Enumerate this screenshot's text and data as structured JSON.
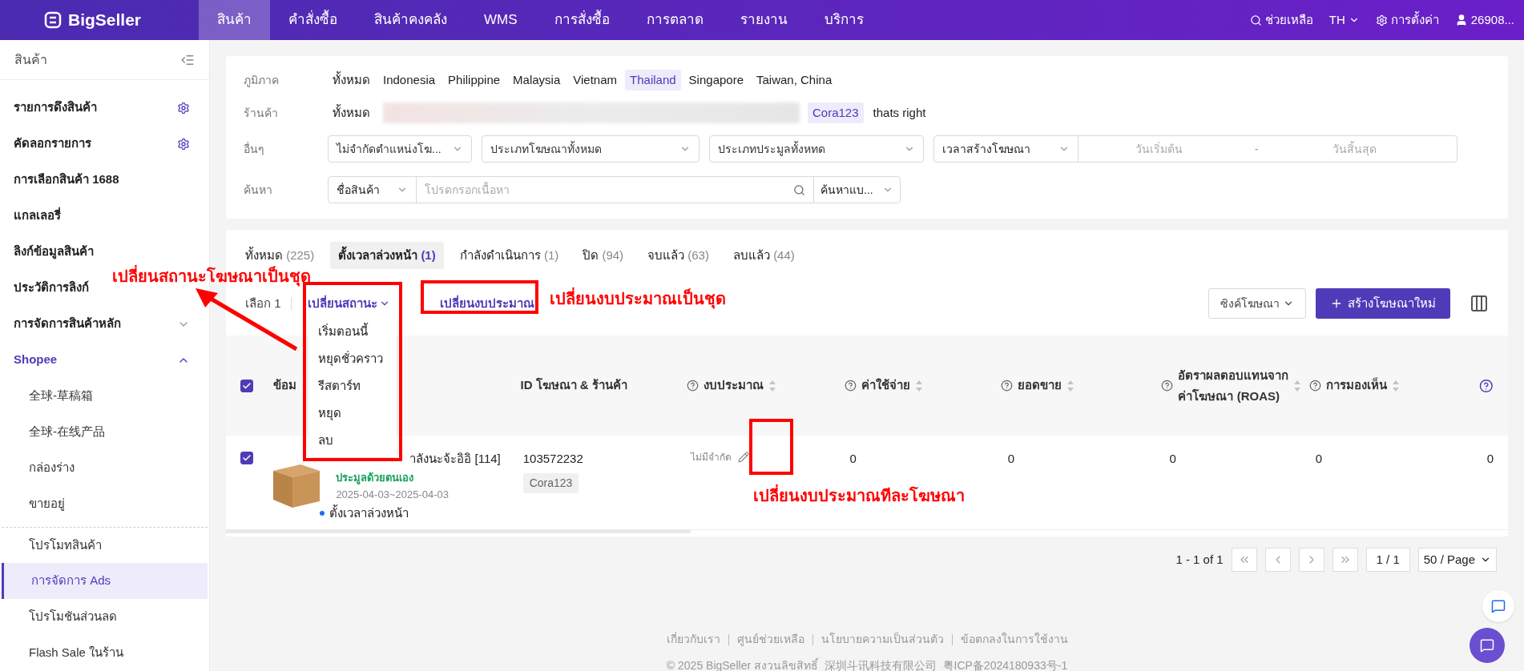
{
  "nav": {
    "logo": "BigSeller",
    "items": [
      {
        "label": "สินค้า",
        "selected": true
      },
      {
        "label": "คำสั่งซื้อ",
        "selected": false
      },
      {
        "label": "สินค้าคงคลัง",
        "selected": false
      },
      {
        "label": "WMS",
        "selected": false
      },
      {
        "label": "การสั่งซื้อ",
        "selected": false
      },
      {
        "label": "การตลาด",
        "selected": false
      },
      {
        "label": "รายงาน",
        "selected": false
      },
      {
        "label": "บริการ",
        "selected": false
      }
    ],
    "help": "ช่วยเหลือ",
    "lang": "TH",
    "settings": "การตั้งค่า",
    "user": "26908..."
  },
  "sidebar": {
    "title": "สินค้า",
    "items": [
      {
        "label": "รายการดึงสินค้า",
        "kind": "gear"
      },
      {
        "label": "คัดลอกรายการ",
        "kind": "gear"
      },
      {
        "label": "การเลือกสินค้า 1688",
        "kind": "plain"
      },
      {
        "label": "แกลเลอรี่",
        "kind": "plain"
      },
      {
        "label": "ลิงก์ข้อมูลสินค้า",
        "kind": "plain"
      },
      {
        "label": "ประวัติการลิงก์",
        "kind": "plain"
      },
      {
        "label": "การจัดการสินค้าหลัก",
        "kind": "group",
        "expanded": false
      },
      {
        "label": "Shopee",
        "kind": "group",
        "expanded": true,
        "children": [
          {
            "label": "全球-草稿箱",
            "selected": false,
            "divider_before": false
          },
          {
            "label": "全球-在线产品",
            "selected": false,
            "divider_before": false
          },
          {
            "label": "กล่องร่าง",
            "selected": false,
            "divider_before": false
          },
          {
            "label": "ขายอยู่",
            "selected": false,
            "divider_before": false
          },
          {
            "label": "โปรโมทสินค้า",
            "selected": false,
            "divider_before": true
          },
          {
            "label": "การจัดการ Ads",
            "selected": true,
            "divider_before": false
          },
          {
            "label": "โปรโมชันส่วนลด",
            "selected": false,
            "divider_before": false
          },
          {
            "label": "Flash Sale ในร้าน",
            "selected": false,
            "divider_before": false
          }
        ]
      }
    ]
  },
  "filters": {
    "region": {
      "label": "ภูมิภาค",
      "options": [
        {
          "label": "ทั้งหมด",
          "selected": false
        },
        {
          "label": "Indonesia",
          "selected": false
        },
        {
          "label": "Philippine",
          "selected": false
        },
        {
          "label": "Malaysia",
          "selected": false
        },
        {
          "label": "Vietnam",
          "selected": false
        },
        {
          "label": "Thailand",
          "selected": true
        },
        {
          "label": "Singapore",
          "selected": false
        },
        {
          "label": "Taiwan, China",
          "selected": false
        }
      ]
    },
    "store": {
      "label": "ร้านค้า",
      "all": "ทั้งหมด",
      "options": [
        {
          "label": "Cora123",
          "selected": true
        },
        {
          "label": "thats right",
          "selected": false
        }
      ]
    },
    "other": {
      "label": "อื่นๆ",
      "selects": [
        "ไม่จำกัดตำแหน่งโฆ...",
        "ประเภทโฆษณาทั้งหมด",
        "ประเภทประมูลทั้งหทด"
      ],
      "date_type": "เวลาสร้างโฆษณา",
      "start_placeholder": "วันเริ่มต้น",
      "separator": "-",
      "end_placeholder": "วันสิ้นสุด"
    },
    "search": {
      "label": "ค้นหา",
      "field": "ชื่อสินค้า",
      "placeholder": "โปรดกรอกเนื้อหา",
      "mode": "ค้นหาแบ..."
    }
  },
  "tabs": [
    {
      "label": "ทั้งหมด",
      "count": "(225)",
      "selected": false
    },
    {
      "label": "ตั้งเวลาล่วงหน้า",
      "count": "(1)",
      "selected": true
    },
    {
      "label": "กำลังดำเนินการ",
      "count": "(1)",
      "selected": false
    },
    {
      "label": "ปิด",
      "count": "(94)",
      "selected": false
    },
    {
      "label": "จบแล้ว",
      "count": "(63)",
      "selected": false
    },
    {
      "label": "ลบแล้ว",
      "count": "(44)",
      "selected": false
    }
  ],
  "toolbar": {
    "selected_count": "เลือก 1",
    "status_button": "เปลี่ยนสถานะ",
    "budget_button": "เปลี่ยนงบประมาณ",
    "sync_button": "ซิงค์โฆษณา",
    "create_button": "สร้างโฆษณาใหม่"
  },
  "status_menu": [
    "เริ่มตอนนี้",
    "หยุดชั่วคราว",
    "รีสตาร์ท",
    "หยุด",
    "ลบ"
  ],
  "table": {
    "all_checked": true,
    "columns": [
      {
        "label": "ข้อม",
        "help": false,
        "sortable": false
      },
      {
        "label": "ID โฆษณา & ร้านค้า",
        "help": false,
        "sortable": false
      },
      {
        "label": "งบประมาณ",
        "help": true,
        "sortable": true
      },
      {
        "label": "ค่าใช้จ่าย",
        "help": true,
        "sortable": true
      },
      {
        "label": "ยอดขาย",
        "help": true,
        "sortable": true
      },
      {
        "label": "อัตราผลตอบแทนจากค่าโฆษณา (ROAS)",
        "help": true,
        "sortable": true
      },
      {
        "label": "การมองเห็น",
        "help": true,
        "sortable": true
      }
    ],
    "rows": [
      {
        "checked": true,
        "name": "าลังนะจ้ะอิอิ [114]",
        "bidding": "ประมูลด้วยตนเอง",
        "dates": "2025-04-03~2025-04-03",
        "status": "ตั้งเวลาล่วงหน้า",
        "ad_id": "103572232",
        "store": "Cora123",
        "budget": "ไม่มีจำกัด",
        "spend": "0",
        "sales": "0",
        "roas": "0",
        "views": "0",
        "column_8": "0"
      }
    ]
  },
  "pagination": {
    "summary": "1 - 1 of 1",
    "page": "1 / 1",
    "page_size": "50 / Page"
  },
  "footer": {
    "links": [
      "เกี่ยวกับเรา",
      "ศูนย์ช่วยเหลือ",
      "นโยบายความเป็นส่วนตัว",
      "ข้อตกลงในการใช้งาน"
    ],
    "copyright": "© 2025 BigSeller สงวนลิขสิทธิ์  深圳斗讯科技有限公司  粤ICP备2024180933号-1"
  },
  "annotations": [
    {
      "kind": "text",
      "text": "เปลี่ยนสถานะโฆษณาเป็นชุด"
    },
    {
      "kind": "arrow"
    },
    {
      "kind": "box"
    },
    {
      "kind": "box"
    },
    {
      "kind": "text",
      "text": "เปลี่ยนงบประมาณเป็นชุด"
    },
    {
      "kind": "box"
    },
    {
      "kind": "text",
      "text": "เปลี่ยนงบประมาณทีละโฆษณา"
    }
  ]
}
